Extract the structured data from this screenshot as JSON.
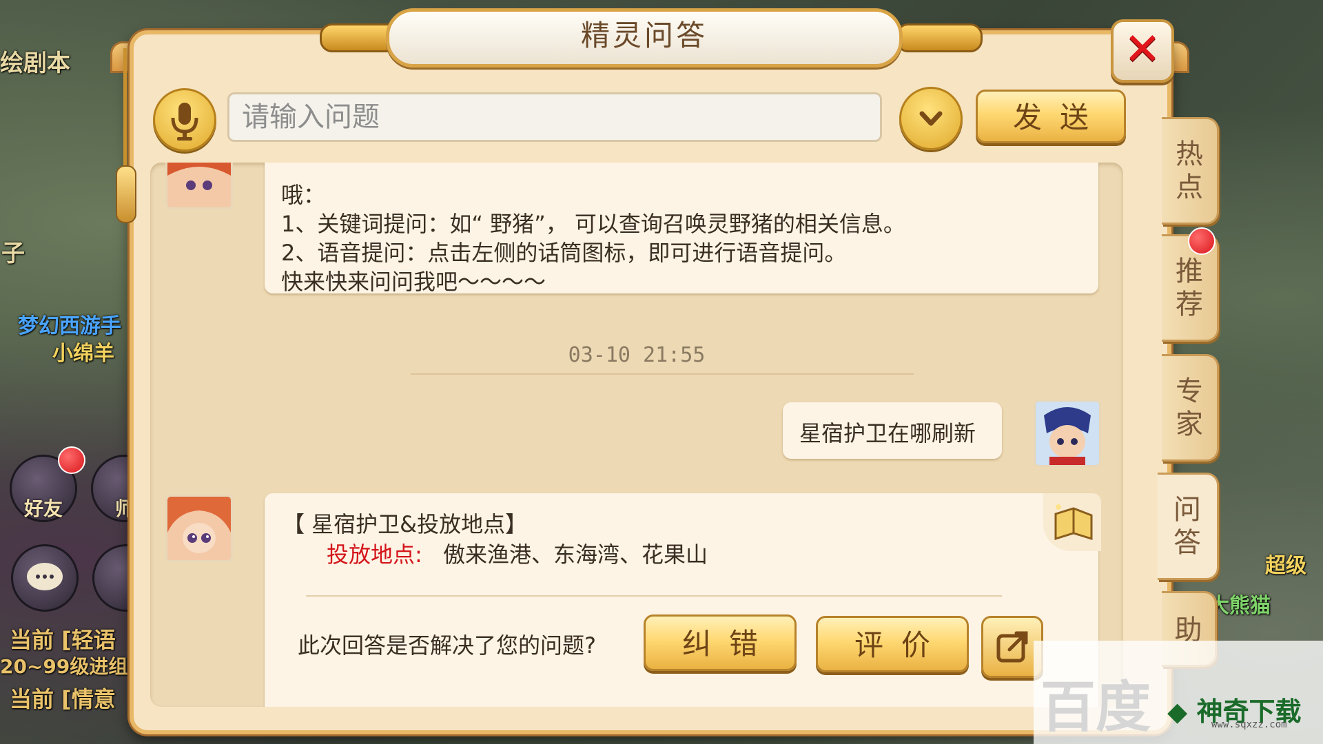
{
  "dialog": {
    "title": "精灵问答",
    "close_label": "✕"
  },
  "input_row": {
    "placeholder": "请输入问题",
    "send_label": "发送"
  },
  "chat": {
    "intro_lines": [
      "哦：",
      "1、关键词提问：如“ 野猪”， 可以查询召唤灵野猪的相关信息。",
      "2、语音提问：点击左侧的话筒图标，即可进行语音提问。",
      "快来快来问问我吧～～～～"
    ],
    "timestamp": "03-10  21:55",
    "user_message": "星宿护卫在哪刷新",
    "answer": {
      "title": "【 星宿护卫&投放地点】",
      "location_label": "投放地点:",
      "location_value": "傲来渔港、东海湾、花果山"
    },
    "feedback_question": "此次回答是否解决了您的问题?",
    "correct_label": "纠错",
    "rate_label": "评价"
  },
  "tabs": [
    {
      "label_1": "热",
      "label_2": "点"
    },
    {
      "label_1": "推",
      "label_2": "荐"
    },
    {
      "label_1": "专",
      "label_2": "家"
    },
    {
      "label_1": "问",
      "label_2": "答"
    },
    {
      "label_1": "助",
      "label_2": ""
    }
  ],
  "active_tab": "问答",
  "background": {
    "text_top_left": "绘剧本",
    "text_zi": "子",
    "player_title": "梦幻西游手",
    "player_name": "小绵羊",
    "friends_label": "好友",
    "master_label": "师",
    "channel_1": "当前 [轻语",
    "channel_2": "20~99级进组",
    "channel_3": "当前 [情意",
    "right_text_1": "超级",
    "right_text_2": "大熊猫"
  },
  "watermark": {
    "baidu": "百度",
    "brand": "神奇下载",
    "url": "www.sqxzz.com"
  },
  "colors": {
    "frame_gold": "#e8b867",
    "panel_bg": "#f6e4c3",
    "chat_bg": "#edd9b3",
    "bubble_bg": "#fdf4e5",
    "highlight_red": "#d4141a",
    "close_red": "#e0161b"
  }
}
